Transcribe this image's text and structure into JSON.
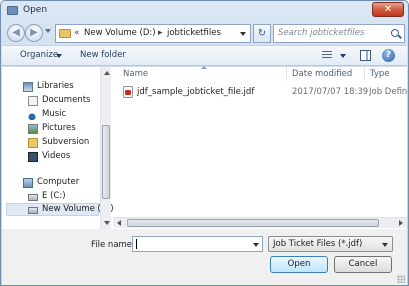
{
  "window": {
    "title": "Open",
    "close_glyph": "✕"
  },
  "navigation": {
    "back_glyph": "◀",
    "forward_glyph": "▶",
    "address": {
      "prefix": "«",
      "segments": [
        "New Volume (D:)",
        "jobticketfiles"
      ],
      "separator": "▸"
    },
    "refresh_glyph": "↻",
    "search_placeholder": "Search jobticketfiles"
  },
  "toolbar": {
    "organize_label": "Organize",
    "new_folder_label": "New folder",
    "help_glyph": "?"
  },
  "sidebar": {
    "items": [
      {
        "label": "Libraries",
        "icon": "library-icon"
      },
      {
        "label": "Documents",
        "icon": "documents-icon"
      },
      {
        "label": "Music",
        "icon": "music-icon"
      },
      {
        "label": "Pictures",
        "icon": "pictures-icon"
      },
      {
        "label": "Subversion",
        "icon": "folder-icon"
      },
      {
        "label": "Videos",
        "icon": "videos-icon"
      },
      {
        "label": "Computer",
        "icon": "computer-icon"
      },
      {
        "label": "E (C:)",
        "icon": "drive-icon"
      },
      {
        "label": "New Volume (D:)",
        "icon": "drive-icon",
        "selected": true
      }
    ]
  },
  "file_list": {
    "columns": {
      "name": "Name",
      "date": "Date modified",
      "type": "Type"
    },
    "rows": [
      {
        "name": "jdf_sample_jobticket_file.jdf",
        "date": "2017/07/07 18:39",
        "type": "Job Defini",
        "icon": "pdf-file-icon"
      }
    ]
  },
  "footer": {
    "file_name_label": "File name:",
    "file_name_value": "",
    "filter_value": "Job Ticket Files (*.jdf)",
    "open_label": "Open",
    "cancel_label": "Cancel"
  },
  "colors": {
    "accent": "#3c7fb1",
    "title_bar": "#c8d9ec",
    "close_button": "#cf5a3d"
  }
}
